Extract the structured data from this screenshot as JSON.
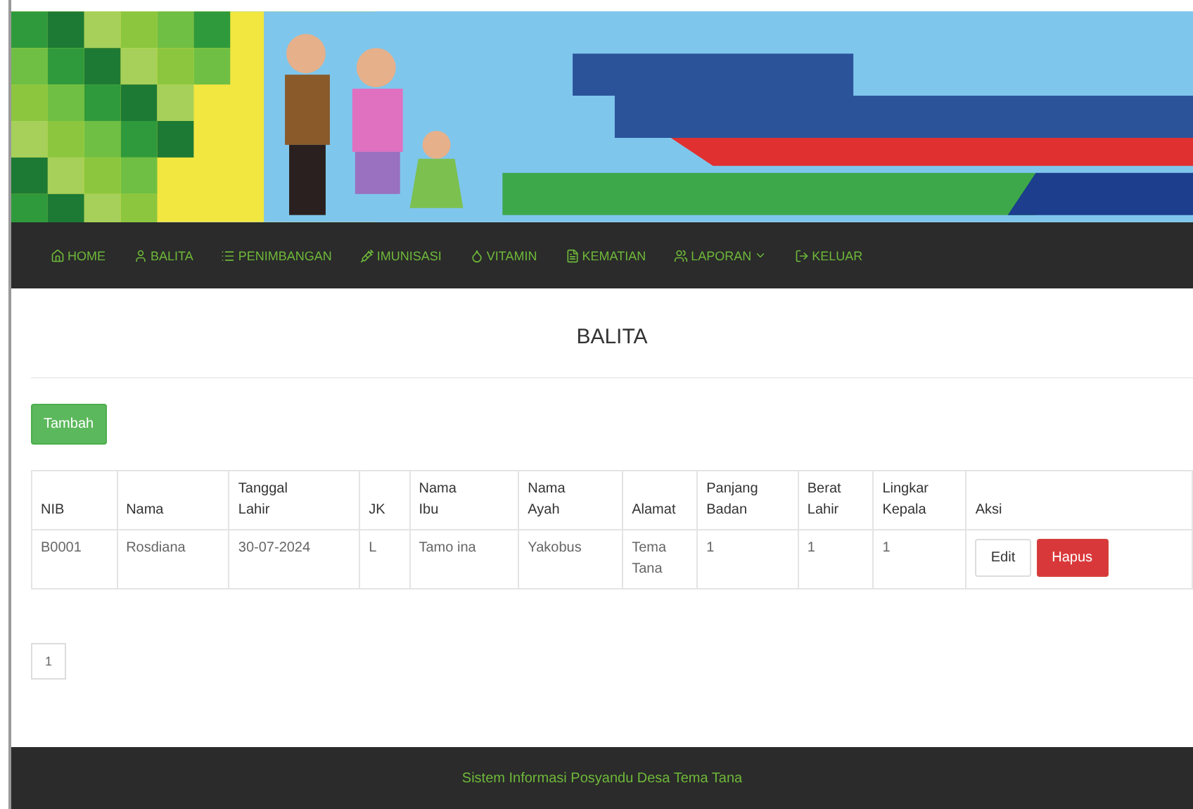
{
  "nav": [
    {
      "label": "HOME",
      "dropdown": false
    },
    {
      "label": "BALITA",
      "dropdown": false
    },
    {
      "label": "PENIMBANGAN",
      "dropdown": false
    },
    {
      "label": "IMUNISASI",
      "dropdown": false
    },
    {
      "label": "VITAMIN",
      "dropdown": false
    },
    {
      "label": "KEMATIAN",
      "dropdown": false
    },
    {
      "label": "LAPORAN",
      "dropdown": true
    },
    {
      "label": "KELUAR",
      "dropdown": false
    }
  ],
  "page_title": "BALITA",
  "add_button": "Tambah",
  "table": {
    "columns": [
      "NIB",
      "Nama",
      "Tanggal Lahir",
      "JK",
      "Nama Ibu",
      "Nama Ayah",
      "Alamat",
      "Panjang Badan",
      "Berat Lahir",
      "Lingkar Kepala",
      "Aksi"
    ],
    "rows": [
      {
        "cells": [
          "B0001",
          "Rosdiana",
          "30-07-2024",
          "L",
          "Tamo ina",
          "Yakobus",
          "Tema Tana",
          "1",
          "1",
          "1"
        ],
        "actions": [
          "Edit",
          "Hapus"
        ]
      }
    ]
  },
  "pagination": [
    "1"
  ],
  "footer": "Sistem Informasi Posyandu Desa Tema Tana"
}
